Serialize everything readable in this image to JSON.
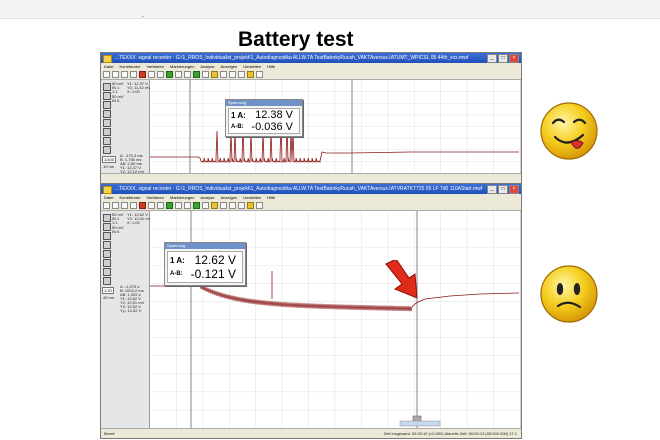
{
  "slide": {
    "title": "Battery test",
    "top_mark": "-"
  },
  "windows": [
    {
      "title": "...TEXXX. signal recorder - G:\\1_RROS_Individualist_projekt\\1_Autodiagnostika ALLW.TA TestBaterkyRucah_VAKTAversus.IATUMT_WPICSL 05 44th_xxx.mwf",
      "menu": [
        "Datei",
        "Korrekturen",
        "Verfahren",
        "Markierungen",
        "Analyse",
        "Anzeigen",
        "Umstellen",
        "Hilfe"
      ],
      "left_panel": {
        "channel_1": [
          "50 mV",
          "IN 1",
          "1:1"
        ],
        "channel_2": [
          "50 mV",
          "IN 6"
        ],
        "readings_a": [
          "Y1: 12,37 V",
          "Y2: 11,42 mV",
          "X: 1:00"
        ],
        "time_scale": "1/100",
        "time_unit": "10 ms",
        "readings_b": [
          "A: -170,3 ms",
          "B: 1,756 ms",
          "AB: 2,60 ms"
        ],
        "readings_c": [
          "Y1: 12,37 V",
          "Y2: 12,12 mV",
          "Y3: 12,37 V",
          "Yₐ= 12,37 V"
        ]
      },
      "readout": {
        "header": "Spannung",
        "label_a": "1 A:",
        "value_a": "12.38 V",
        "label_ab": "A-B:",
        "value_ab": "-0.036 V"
      },
      "status_left": "",
      "status_right": ""
    },
    {
      "title": "...TEXXX. signal recorder - G:\\1_RROS_Individualist_projekt\\1_Autodiagnostika ALLW.TA TestBaterkyRucah_VAKTAversus.IATVRATKT725 05 LF 7d0 110AStart.mwf",
      "menu": [
        "Datei",
        "Korrekturen",
        "Verfahren",
        "Markierungen",
        "Analyse",
        "Anzeigen",
        "Umstellen",
        "Hilfe"
      ],
      "left_panel": {
        "channel_1": [
          "50 mV",
          "IN 1",
          "1:1"
        ],
        "channel_2": [
          "50 mV",
          "IN 6"
        ],
        "readings_a": [
          "Y1: 12,62 V",
          "Y2: 12,41 mV",
          "X: 1:00"
        ],
        "time_scale": "1:20",
        "time_unit": "40 ms",
        "readings_b": [
          "A: -1,070 s",
          "B: 1004,2 ms",
          "AB: 1,002 s"
        ],
        "readings_c": [
          "Y1: 12,62 V",
          "Y2: 12,51 mV",
          "Y3: 12,52 V",
          "Yₐ= 12,62 V"
        ]
      },
      "readout": {
        "header": "Spannung",
        "label_a": "1 A:",
        "value_a": "12.62 V",
        "label_ab": "A-B:",
        "value_ab": "-0.121 V"
      },
      "status_left": "Bereit",
      "status_right": "Zeit insgesamt: 00:00:10 (×0,000)   Aktuelle Zeit: 00:00:13 (00:000 000)   17.1"
    }
  ],
  "colors": {
    "signal": "#8b1a1a",
    "arrow": "#e02a1a",
    "smiley": "#f2c21a"
  },
  "icons": [
    "happy-tongue-smiley",
    "worried-smiley",
    "red-arrow"
  ]
}
